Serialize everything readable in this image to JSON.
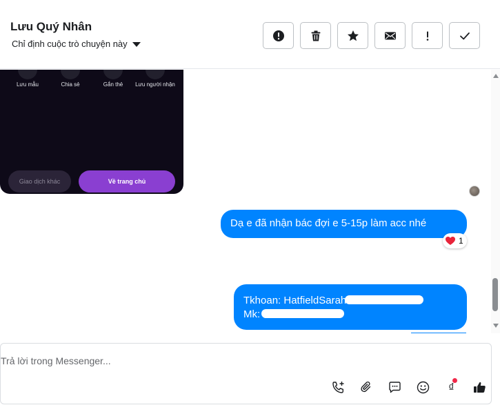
{
  "header": {
    "contact_name": "Lưu Quý Nhân",
    "assign_label": "Chỉ định cuộc trò chuyện này",
    "toolbar": [
      {
        "name": "spam-button",
        "icon": "alert-circle-icon"
      },
      {
        "name": "delete-button",
        "icon": "trash-icon"
      },
      {
        "name": "star-button",
        "icon": "star-icon"
      },
      {
        "name": "mark-unread-button",
        "icon": "envelope-icon"
      },
      {
        "name": "follow-up-button",
        "icon": "exclamation-icon"
      },
      {
        "name": "done-button",
        "icon": "check-icon"
      }
    ]
  },
  "card": {
    "labels": [
      "Lưu mẫu",
      "Chia sẻ",
      "Gắn thẻ",
      "Lưu người nhận"
    ],
    "other_transaction_label": "Giao dịch khác",
    "home_label": "Về trang chủ"
  },
  "messages": [
    {
      "text": "Dạ e đã nhận bác đợi e 5-15p làm acc nhé",
      "reaction": {
        "emoji": "heart-icon",
        "count": "1"
      }
    },
    {
      "line1": "Tkhoan: HatfieldSarah",
      "line2": "Mk:"
    }
  ],
  "composer": {
    "placeholder": "Trả lời trong Messenger...",
    "currency_symbol": "₫"
  },
  "colors": {
    "bubble": "#0084ff",
    "card_bg": "#0e0a18",
    "card_primary": "#8a3fd1",
    "notify_dot": "#f02849"
  }
}
